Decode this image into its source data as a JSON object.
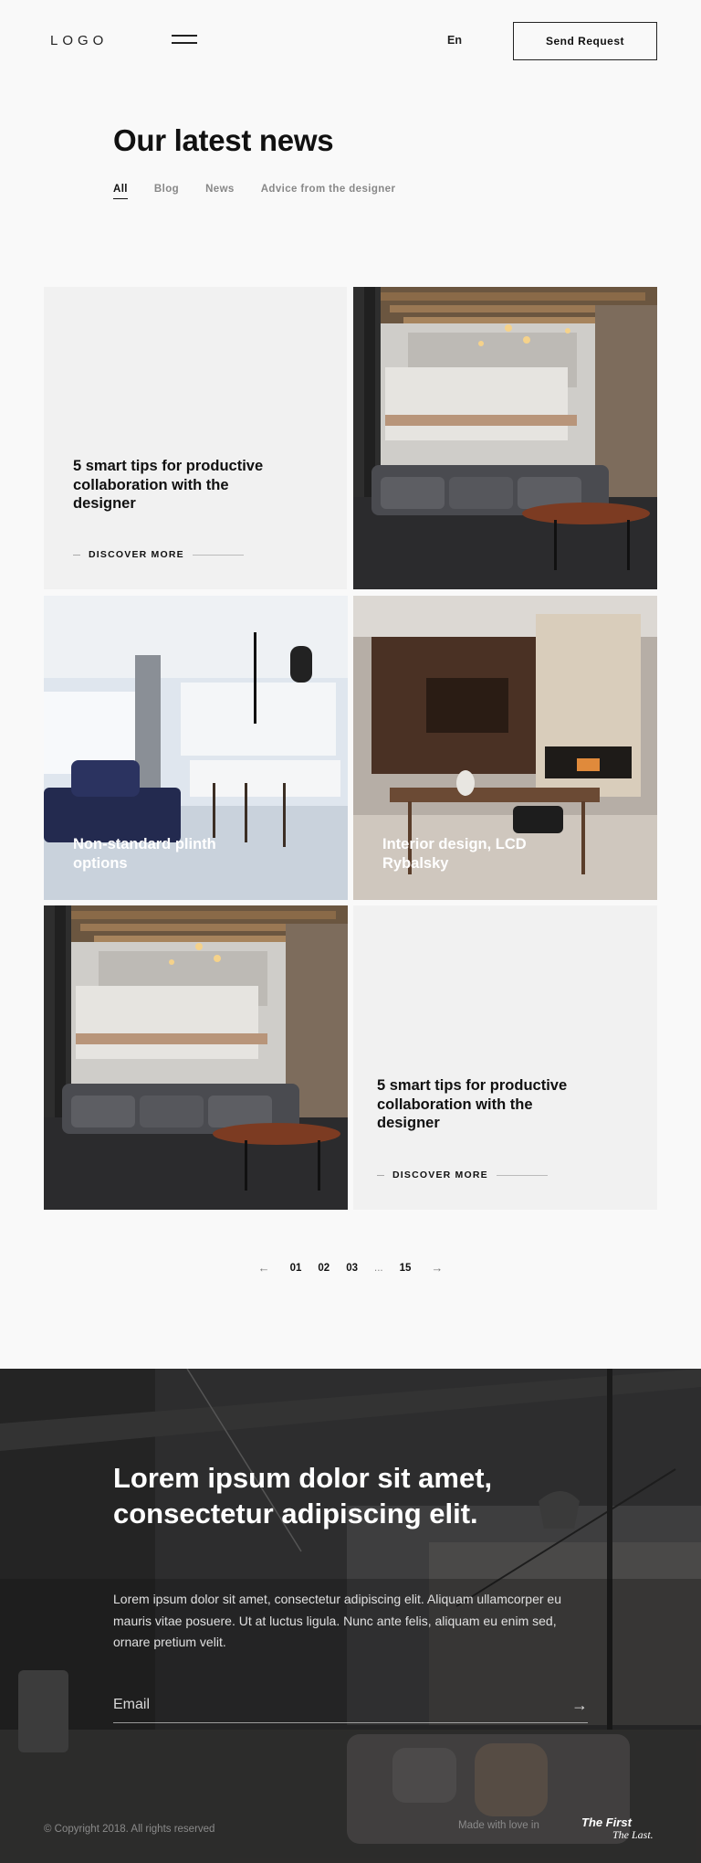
{
  "header": {
    "logo": "LOGO",
    "language": "En",
    "send_request": "Send Request"
  },
  "page": {
    "title": "Our latest news",
    "filters": [
      "All",
      "Blog",
      "News",
      "Advice from the designer"
    ],
    "active_filter": "All"
  },
  "articles": [
    {
      "title": "5 smart tips for productive collaboration with the designer",
      "cta": "DISCOVER MORE"
    },
    {
      "title": "Non-standard plinth options"
    },
    {
      "title": "Interior design, LCD Rybalsky"
    },
    {
      "title": "5 smart tips for productive collaboration with the designer",
      "cta": "DISCOVER MORE"
    }
  ],
  "pagination": {
    "pages": [
      "01",
      "02",
      "03",
      "...",
      "15"
    ],
    "prev_icon": "arrow-left-icon",
    "next_icon": "arrow-right-icon"
  },
  "footer": {
    "heading": "Lorem ipsum dolor sit amet, consectetur adipiscing elit.",
    "text": "Lorem ipsum dolor sit amet, consectetur adipiscing elit. Aliquam ullamcorper eu mauris vitae posuere. Ut at luctus ligula. Nunc ante felis, aliquam eu enim sed, ornare pretium velit.",
    "email_placeholder": "Email",
    "copyright": "© Copyright 2018. All rights reserved",
    "made_with": "Made with love in",
    "brand_line1": "The First",
    "brand_line2": "The Last."
  },
  "colors": {
    "background": "#f9f9f9",
    "card": "#f1f1f1",
    "text": "#111111",
    "muted": "#888888"
  }
}
